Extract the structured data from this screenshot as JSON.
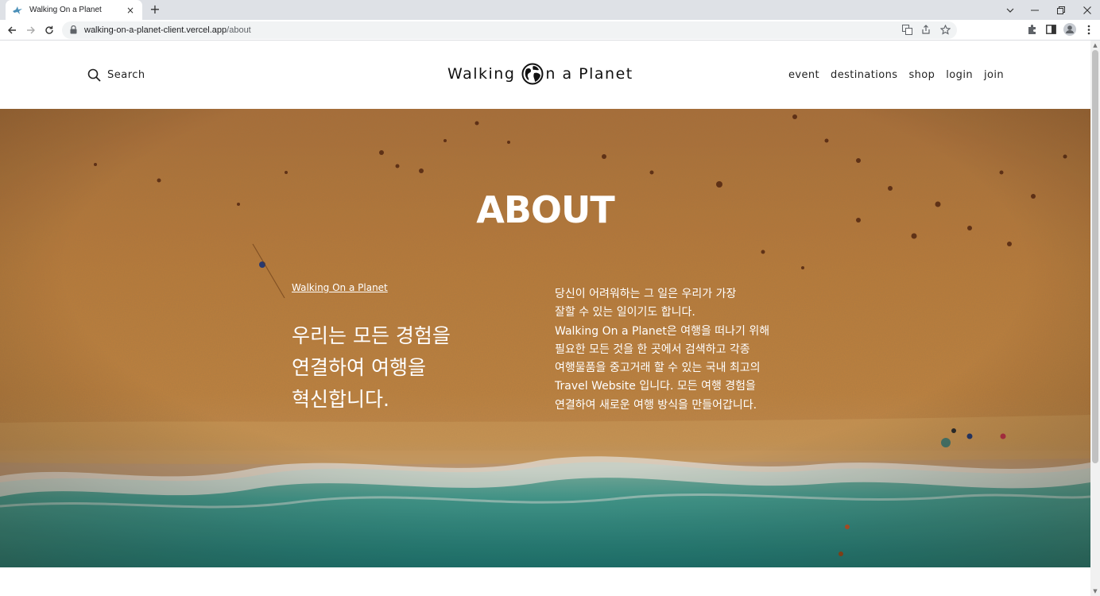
{
  "browser": {
    "tab_title": "Walking On a Planet",
    "tab_close": "×",
    "new_tab": "+",
    "url_host": "walking-on-a-planet-client.vercel.app",
    "url_path": "/about"
  },
  "header": {
    "search_label": "Search",
    "logo_part1": "Walking",
    "logo_part2": "n a Planet",
    "nav": [
      "event",
      "destinations",
      "shop",
      "login",
      "join"
    ]
  },
  "hero": {
    "title": "ABOUT",
    "link": "Walking On a Planet",
    "headline_lines": [
      "우리는 모든 경험을",
      "연결하여 여행을",
      "혁신합니다."
    ],
    "body_lines": [
      "당신이 어려워하는 그 일은 우리가 가장",
      "잘할 수 있는 일이기도 합니다.",
      "Walking On a Planet은 여행을 떠나기 위해",
      "필요한 모든 것을 한 곳에서 검색하고 각종",
      "여행물품을 중고거래 할 수 있는 국내 최고의",
      "Travel Website 입니다. 모든 여행 경험을",
      "연결하여 새로운 여행 방식을 만들어갑니다."
    ]
  },
  "colors": {
    "sand": "#c98a45",
    "sea": "#2f9d95",
    "text_dark": "#222222"
  }
}
